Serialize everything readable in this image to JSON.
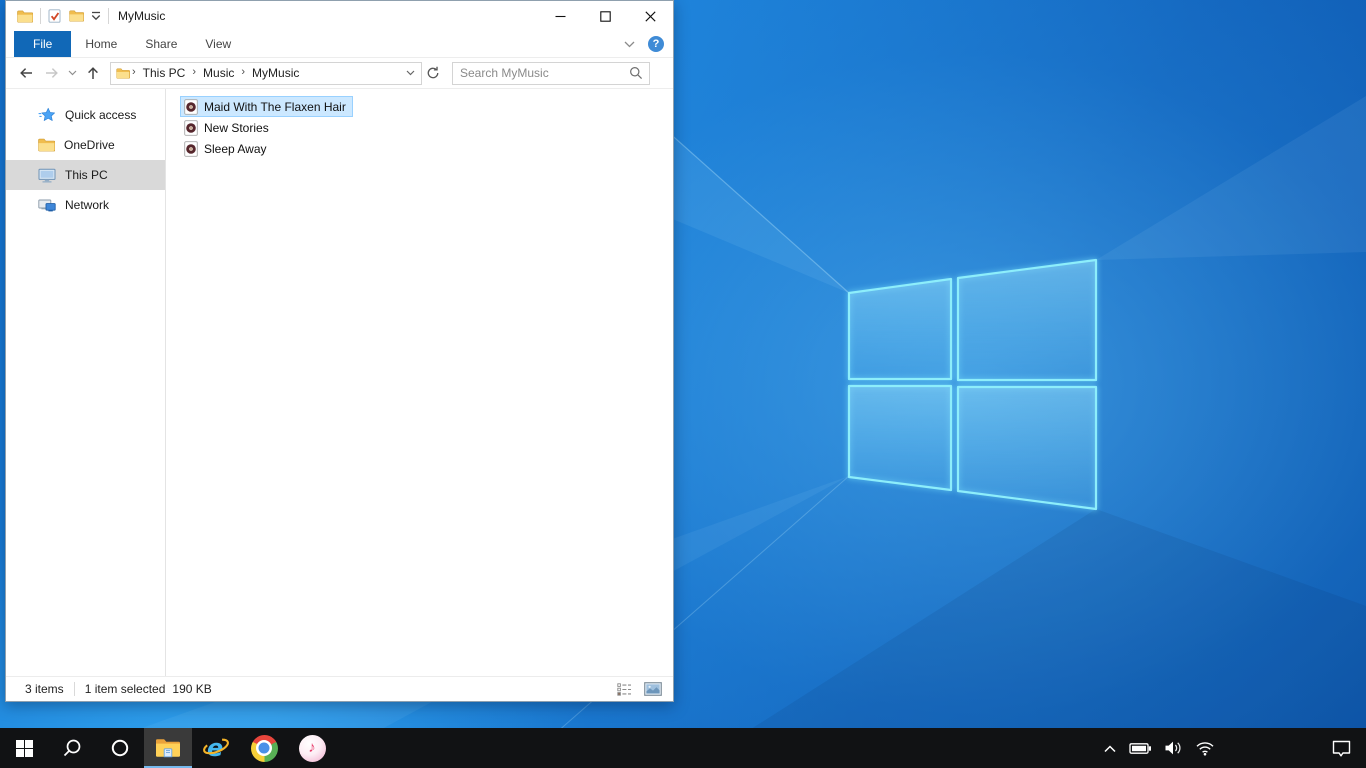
{
  "window": {
    "title": "MyMusic",
    "ribbon_tabs": [
      {
        "label": "File",
        "active": true
      },
      {
        "label": "Home",
        "active": false
      },
      {
        "label": "Share",
        "active": false
      },
      {
        "label": "View",
        "active": false
      }
    ],
    "help_label": "?",
    "breadcrumb": [
      "This PC",
      "Music",
      "MyMusic"
    ],
    "search_placeholder": "Search MyMusic",
    "sidebar_items": [
      {
        "label": "Quick access",
        "icon": "quick-access-star-icon",
        "selected": false
      },
      {
        "label": "OneDrive",
        "icon": "folder-icon",
        "selected": false
      },
      {
        "label": "This PC",
        "icon": "monitor-icon",
        "selected": true
      },
      {
        "label": "Network",
        "icon": "network-icon",
        "selected": false
      }
    ],
    "files": [
      {
        "name": "Maid With The Flaxen Hair",
        "icon": "music-file-icon",
        "selected": true
      },
      {
        "name": "New Stories",
        "icon": "music-file-icon",
        "selected": false
      },
      {
        "name": "Sleep Away",
        "icon": "music-file-icon",
        "selected": false
      }
    ],
    "status": {
      "items_count": "3 items",
      "selection": "1 item selected",
      "selection_size": "190 KB"
    },
    "quick_access_toolbar_icons": [
      "folder-icon",
      "properties-check-icon",
      "new-folder-icon",
      "customize-chevron-icon"
    ],
    "caption_icons": [
      "minimize-icon",
      "maximize-icon",
      "close-icon"
    ]
  },
  "taskbar": {
    "buttons": [
      {
        "icon": "start-icon",
        "active": false
      },
      {
        "icon": "search-icon",
        "active": false
      },
      {
        "icon": "cortana-icon",
        "active": false
      },
      {
        "icon": "file-explorer-icon",
        "active": true
      },
      {
        "icon": "internet-explorer-icon",
        "active": false
      },
      {
        "icon": "chrome-icon",
        "active": false
      },
      {
        "icon": "itunes-icon",
        "active": false
      }
    ],
    "tray_icons": [
      "hidden-icons-chevron-icon",
      "battery-icon",
      "volume-icon",
      "wifi-icon",
      "action-center-icon"
    ],
    "itunes_note_glyph": "♪",
    "ie_glyph": "e"
  },
  "colors": {
    "file_tab_blue": "#1168b7",
    "selection_fill": "#cce8ff",
    "selection_border": "#99d1ff",
    "sidebar_selected": "#d9d9d9",
    "taskbar_bg": "#111214",
    "taskbar_active_underline": "#76b9ed",
    "wallpaper_base": "#1264bd",
    "logo_stroke": "#8deefb",
    "help_circle": "#3f8bd6"
  }
}
